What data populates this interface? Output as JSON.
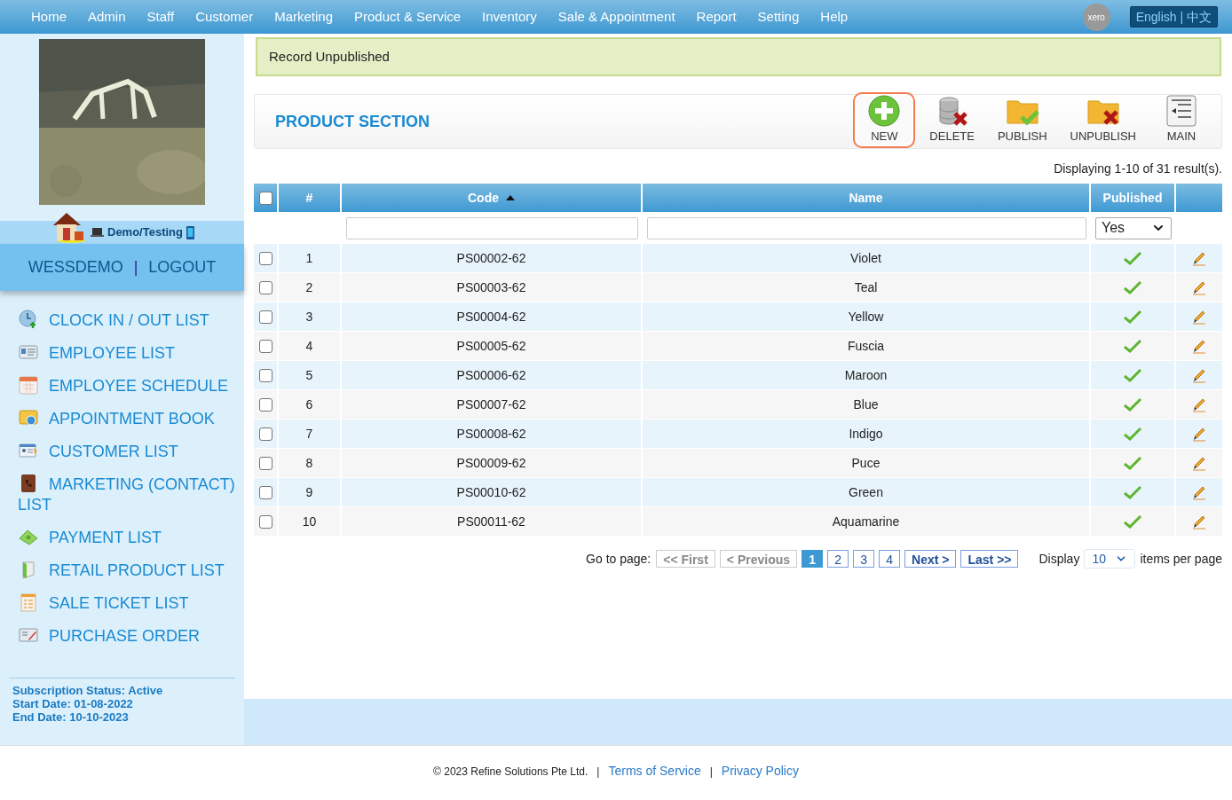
{
  "nav": {
    "items": [
      "Home",
      "Admin",
      "Staff",
      "Customer",
      "Marketing",
      "Product & Service",
      "Inventory",
      "Sale & Appointment",
      "Report",
      "Setting",
      "Help"
    ],
    "xero": "xero",
    "language": "English | 中文"
  },
  "sidebar": {
    "photo": {
      "kind": "picture"
    },
    "env_label": "Demo/Testing",
    "user": "WESSDEMO",
    "separator": "|",
    "logout": "LOGOUT",
    "items": [
      "CLOCK IN / OUT LIST",
      "EMPLOYEE LIST",
      "EMPLOYEE SCHEDULE",
      "APPOINTMENT BOOK",
      "CUSTOMER LIST",
      "MARKETING (CONTACT) LIST",
      "PAYMENT LIST",
      "RETAIL PRODUCT LIST",
      "SALE TICKET LIST",
      "PURCHASE ORDER"
    ],
    "subscription": [
      "Subscription Status: Active",
      "Start Date: 01-08-2022",
      "End Date: 10-10-2023"
    ]
  },
  "alert": "Record Unpublished",
  "section": {
    "title": "PRODUCT SECTION",
    "toolbar": [
      {
        "kind": "new",
        "label": "NEW",
        "highlighted": true
      },
      {
        "kind": "delete",
        "label": "DELETE",
        "highlighted": false
      },
      {
        "kind": "publish",
        "label": "PUBLISH",
        "highlighted": false
      },
      {
        "kind": "unpublish",
        "label": "UNPUBLISH",
        "highlighted": false
      },
      {
        "kind": "main",
        "label": "MAIN",
        "highlighted": false
      }
    ]
  },
  "result_count": "Displaying 1-10 of 31 result(s).",
  "table": {
    "select_all": {
      "checked": false
    },
    "columns": [
      {
        "label": "#",
        "sorted": false
      },
      {
        "label": "Code",
        "sorted": true
      },
      {
        "label": "Name",
        "sorted": false
      },
      {
        "label": "Published",
        "sorted": false
      }
    ],
    "published_filter": "Yes",
    "rows": [
      {
        "number": "1",
        "code": "PS00002-62",
        "name": "Violet",
        "published": true,
        "checked": false
      },
      {
        "number": "2",
        "code": "PS00003-62",
        "name": "Teal",
        "published": true,
        "checked": false
      },
      {
        "number": "3",
        "code": "PS00004-62",
        "name": "Yellow",
        "published": true,
        "checked": false
      },
      {
        "number": "4",
        "code": "PS00005-62",
        "name": "Fuscia",
        "published": true,
        "checked": false
      },
      {
        "number": "5",
        "code": "PS00006-62",
        "name": "Maroon",
        "published": true,
        "checked": false
      },
      {
        "number": "6",
        "code": "PS00007-62",
        "name": "Blue",
        "published": true,
        "checked": false
      },
      {
        "number": "7",
        "code": "PS00008-62",
        "name": "Indigo",
        "published": true,
        "checked": false
      },
      {
        "number": "8",
        "code": "PS00009-62",
        "name": "Puce",
        "published": true,
        "checked": false
      },
      {
        "number": "9",
        "code": "PS00010-62",
        "name": "Green",
        "published": true,
        "checked": false
      },
      {
        "number": "10",
        "code": "PS00011-62",
        "name": "Aquamarine",
        "published": true,
        "checked": false
      }
    ]
  },
  "pagination": {
    "label": "Go to page:",
    "first": {
      "label": "<< First",
      "disabled": true
    },
    "previous": {
      "label": "< Previous",
      "disabled": true
    },
    "pages": [
      {
        "label": "1",
        "selected": true
      },
      {
        "label": "2",
        "selected": false
      },
      {
        "label": "3",
        "selected": false
      },
      {
        "label": "4",
        "selected": false
      }
    ],
    "next": {
      "label": "Next >",
      "disabled": false
    },
    "last": {
      "label": "Last >>",
      "disabled": false
    },
    "display_label": "Display",
    "per_page": "10",
    "per_page_suffix": "items per page"
  },
  "footer": {
    "copyright": "© 2023 Refine Solutions Pte Ltd.",
    "separator": "|",
    "links": [
      "Terms of Service",
      "Privacy Policy"
    ]
  }
}
